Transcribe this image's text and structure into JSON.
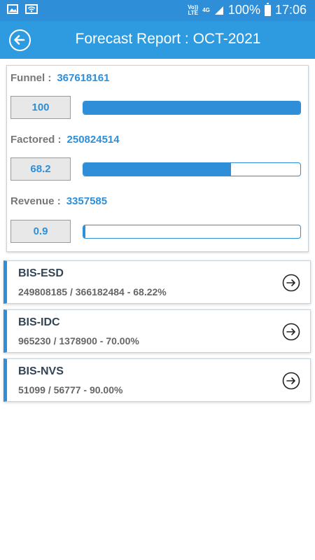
{
  "status_bar": {
    "volte": [
      "Vo))",
      "LTE"
    ],
    "network": "4G",
    "sim": "R",
    "battery": "100%",
    "time": "17:06",
    "icons": [
      "image-icon",
      "wifi-icon",
      "signal-icon",
      "battery-icon"
    ]
  },
  "header": {
    "title": "Forecast Report : OCT-2021",
    "back_icon": "back-arrow-icon",
    "color": "#2e9be0"
  },
  "summary": {
    "rows": [
      {
        "label": "Funnel :",
        "value": "367618161",
        "percent_text": "100",
        "percent": 100
      },
      {
        "label": "Factored :",
        "value": "250824514",
        "percent_text": "68.2",
        "percent": 68.2
      },
      {
        "label": "Revenue :",
        "value": "3357585",
        "percent_text": "0.9",
        "percent": 0.9
      }
    ],
    "accent_color": "#2e8fd8"
  },
  "divisions": [
    {
      "name": "BIS-ESD",
      "detail": "249808185 / 366182484 - 68.22%"
    },
    {
      "name": "BIS-IDC",
      "detail": "965230 / 1378900 - 70.00%"
    },
    {
      "name": "BIS-NVS",
      "detail": "51099 / 56777 - 90.00%"
    }
  ]
}
